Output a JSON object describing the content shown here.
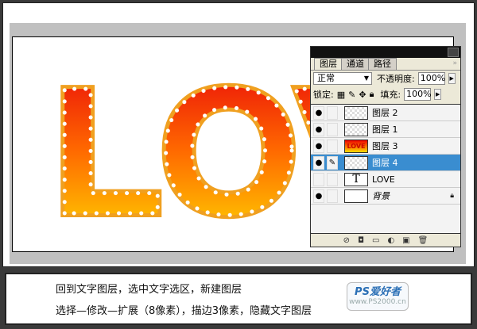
{
  "artwork_text": "LOVE",
  "colors": {
    "grad_top": "#e8000a",
    "grad_bottom": "#ffe000",
    "outline": "#f0a020",
    "selected": "#3a8dd0"
  },
  "palette": {
    "tabs": [
      "图层",
      "通道",
      "路径"
    ],
    "blend_mode": "正常",
    "opacity_label": "不透明度:",
    "opacity": "100%",
    "lock_label": "锁定:",
    "fill_label": "填充:",
    "fill": "100%",
    "layers": [
      {
        "name": "图层 2",
        "visible": true
      },
      {
        "name": "图层 1",
        "visible": true
      },
      {
        "name": "图层 3",
        "visible": true,
        "thumb": "LOVE"
      },
      {
        "name": "图层 4",
        "visible": true,
        "selected": true
      },
      {
        "name": "LOVE",
        "visible": false,
        "thumb": "T"
      },
      {
        "name": "背景",
        "visible": true,
        "locked": true
      }
    ]
  },
  "caption": {
    "line1": "回到文字图层，选中文字选区，新建图层",
    "line2": "选择—修改—扩展（8像素），描边3像素，隐藏文字图层"
  },
  "logo": {
    "title": "PS爱好者",
    "url": "www.PS2000.cn"
  }
}
